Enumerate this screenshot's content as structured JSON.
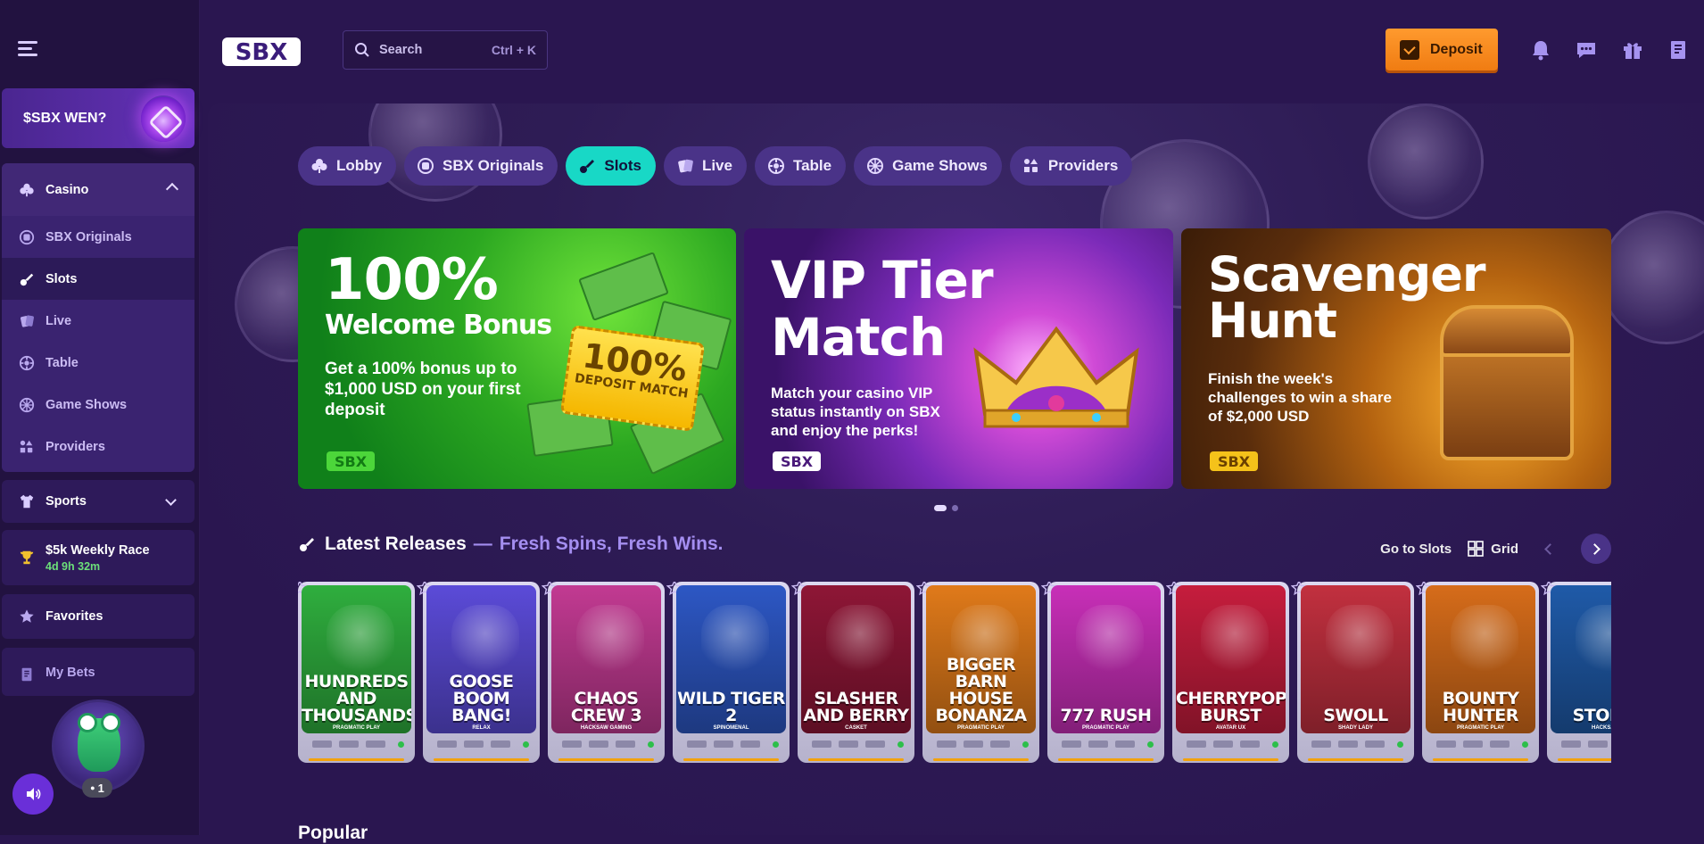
{
  "header": {
    "search_placeholder": "Search",
    "search_shortcut": "Ctrl + K",
    "deposit_label": "Deposit"
  },
  "sidebar": {
    "promo_label": "$SBX WEN?",
    "casino": {
      "label": "Casino",
      "items": [
        {
          "label": "SBX Originals",
          "icon": "originals-icon"
        },
        {
          "label": "Slots",
          "icon": "slots-icon",
          "active": true
        },
        {
          "label": "Live",
          "icon": "live-cards-icon"
        },
        {
          "label": "Table",
          "icon": "roulette-icon"
        },
        {
          "label": "Game Shows",
          "icon": "wheel-icon"
        },
        {
          "label": "Providers",
          "icon": "providers-icon"
        }
      ]
    },
    "sports_label": "Sports",
    "race_label": "$5k Weekly Race",
    "race_time": "4d 9h 32m",
    "favorites_label": "Favorites",
    "mybets_label": "My Bets",
    "avatar_badge": "1"
  },
  "tabs": [
    {
      "label": "Lobby"
    },
    {
      "label": "SBX Originals"
    },
    {
      "label": "Slots",
      "active": true
    },
    {
      "label": "Live"
    },
    {
      "label": "Table"
    },
    {
      "label": "Game Shows"
    },
    {
      "label": "Providers"
    }
  ],
  "banners": [
    {
      "title_big": "100%",
      "title_med": "Welcome Bonus",
      "body": "Get a 100% bonus up to $1,000 USD on your first deposit",
      "ticket_big": "100%",
      "ticket_small": "DEPOSIT MATCH"
    },
    {
      "title_line1": "VIP Tier",
      "title_line2": "Match",
      "body": "Match your casino VIP status instantly on SBX and enjoy the perks!"
    },
    {
      "title_line1": "Scavenger",
      "title_line2": "Hunt",
      "body": "Finish the week's challenges to win a share of $2,000 USD"
    }
  ],
  "carousel": {
    "pages": 2,
    "current": 1
  },
  "latest": {
    "title": "Latest Releases",
    "dash": "—",
    "subtitle": "Fresh Spins, Fresh Wins.",
    "goto_label": "Go to Slots",
    "grid_label": "Grid",
    "games": [
      {
        "title": "HUNDREDS AND THOUSANDS",
        "provider": "PRAGMATIC PLAY",
        "color": "#2fae3e"
      },
      {
        "title": "GOOSE BOOM BANG!",
        "provider": "RELAX",
        "color": "#5b4bd8"
      },
      {
        "title": "CHAOS CREW 3",
        "provider": "HACKSAW GAMING",
        "color": "#c23a92"
      },
      {
        "title": "WILD TIGER 2",
        "provider": "SPINOMENAL",
        "color": "#2d57c4"
      },
      {
        "title": "SLASHER AND BERRY",
        "provider": "CASKET",
        "color": "#8e1636"
      },
      {
        "title": "BIGGER BARN HOUSE BONANZA",
        "provider": "PRAGMATIC PLAY",
        "color": "#e07a1a"
      },
      {
        "title": "777 RUSH",
        "provider": "PRAGMATIC PLAY",
        "color": "#c82fb8"
      },
      {
        "title": "CHERRYPOP BURST",
        "provider": "AVATAR UX",
        "color": "#c61d3d"
      },
      {
        "title": "SWOLL",
        "provider": "SHADY LADY",
        "color": "#c2303f"
      },
      {
        "title": "BOUNTY HUNTER",
        "provider": "PRAGMATIC PLAY",
        "color": "#d66c1a"
      },
      {
        "title": "STORM",
        "provider": "HACKSAW",
        "color": "#1f5aa8"
      }
    ]
  },
  "popular_title": "Popular",
  "colors": {
    "accent": "#18d8c6",
    "deposit": "#f58a1f",
    "brand_purple": "#4a3388"
  }
}
